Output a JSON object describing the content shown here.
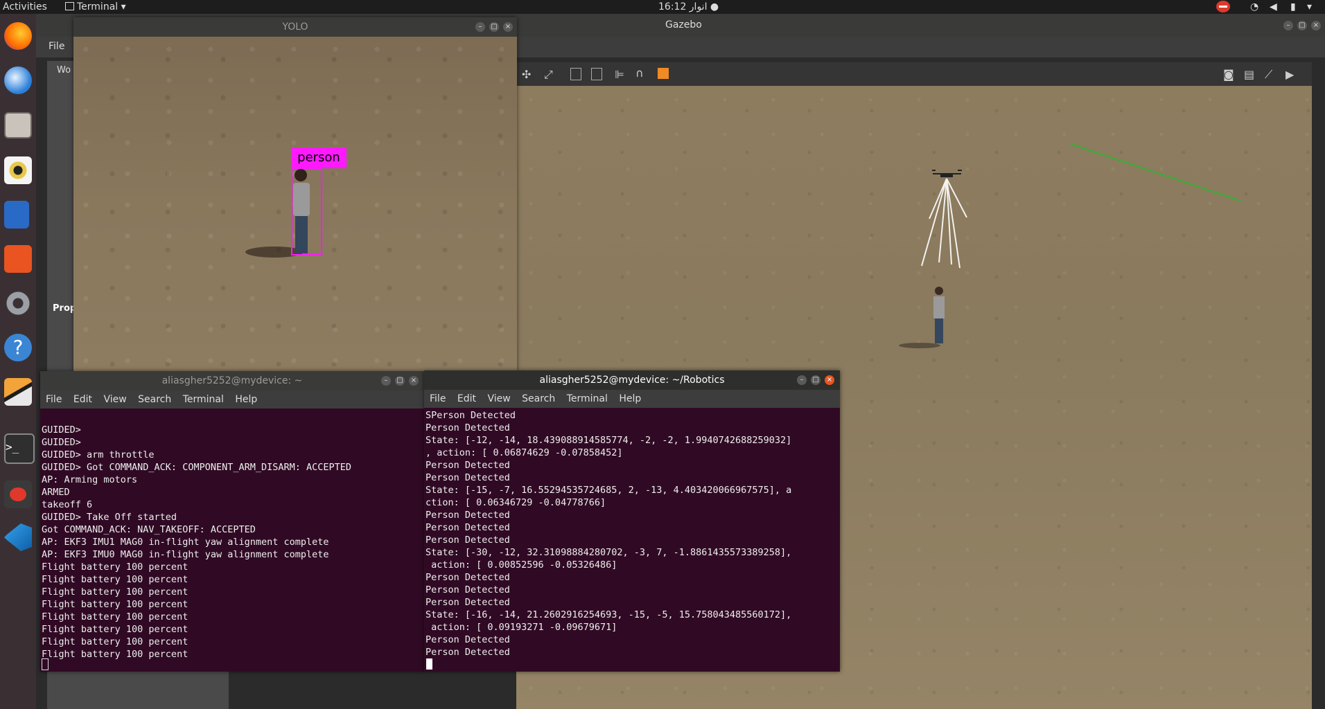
{
  "topbar": {
    "activities": "Activities",
    "app_menu": "Terminal",
    "clock": "16:12 انوار"
  },
  "gazebo": {
    "title": "Gazebo",
    "menu_file": "File",
    "panel_world": "Wo",
    "panel_prop": "Prop"
  },
  "yolo": {
    "title": "YOLO",
    "detection_label": "person"
  },
  "term_left": {
    "title": "aliasgher5252@mydevice: ~",
    "menu": [
      "File",
      "Edit",
      "View",
      "Search",
      "Terminal",
      "Help"
    ],
    "lines": "\nGUIDED>\nGUIDED>\nGUIDED> arm throttle\nGUIDED> Got COMMAND_ACK: COMPONENT_ARM_DISARM: ACCEPTED\nAP: Arming motors\nARMED\ntakeoff 6\nGUIDED> Take Off started\nGot COMMAND_ACK: NAV_TAKEOFF: ACCEPTED\nAP: EKF3 IMU1 MAG0 in-flight yaw alignment complete\nAP: EKF3 IMU0 MAG0 in-flight yaw alignment complete\nFlight battery 100 percent\nFlight battery 100 percent\nFlight battery 100 percent\nFlight battery 100 percent\nFlight battery 100 percent\nFlight battery 100 percent\nFlight battery 100 percent\nFlight battery 100 percent"
  },
  "term_right": {
    "title": "aliasgher5252@mydevice: ~/Robotics",
    "menu": [
      "File",
      "Edit",
      "View",
      "Search",
      "Terminal",
      "Help"
    ],
    "lines": "SPerson Detected\nPerson Detected\nState: [-12, -14, 18.439088914585774, -2, -2, 1.9940742688259032]\n, action: [ 0.06874629 -0.07858452]\nPerson Detected\nPerson Detected\nState: [-15, -7, 16.55294535724685, 2, -13, 4.403420066967575], a\nction: [ 0.06346729 -0.04778766]\nPerson Detected\nPerson Detected\nPerson Detected\nState: [-30, -12, 32.31098884280702, -3, 7, -1.8861435573389258],\n action: [ 0.00852596 -0.05326486]\nPerson Detected\nPerson Detected\nPerson Detected\nState: [-16, -14, 21.2602916254693, -15, -5, 15.758043485560172],\n action: [ 0.09193271 -0.09679671]\nPerson Detected\nPerson Detected"
  },
  "dock": {
    "icons": [
      "firefox-icon",
      "thunderbird-icon",
      "files-icon",
      "rhythmbox-icon",
      "writer-icon",
      "software-icon",
      "settings-icon",
      "help-icon",
      "layers-icon",
      "terminal-icon",
      "no-entry-icon",
      "vscode-icon"
    ]
  }
}
